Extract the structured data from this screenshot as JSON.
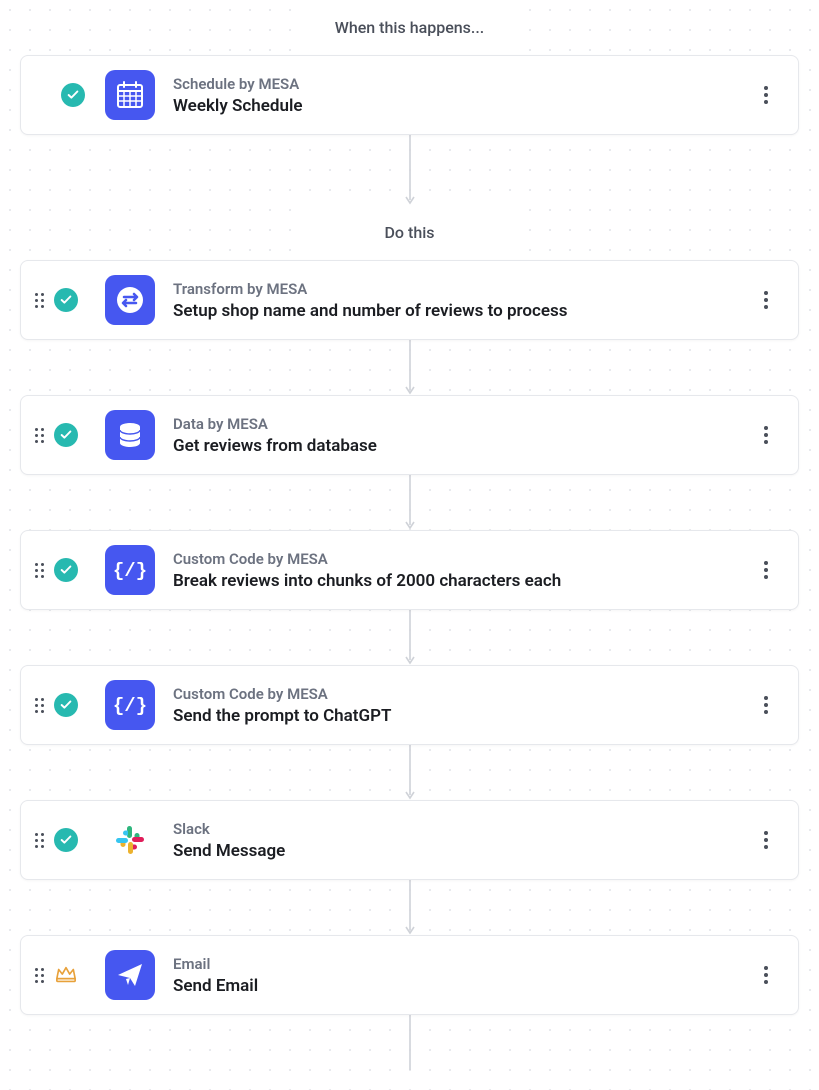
{
  "sections": {
    "trigger_header": "When this happens...",
    "actions_header": "Do this"
  },
  "trigger": {
    "app": "Schedule by MESA",
    "title": "Weekly Schedule",
    "status": "checked",
    "icon": "calendar"
  },
  "actions": [
    {
      "app": "Transform by MESA",
      "title": "Setup shop name and number of reviews to process",
      "status": "checked",
      "icon": "transform"
    },
    {
      "app": "Data by MESA",
      "title": "Get reviews from database",
      "status": "checked",
      "icon": "database"
    },
    {
      "app": "Custom Code by MESA",
      "title": "Break reviews into chunks of 2000 characters each",
      "status": "checked",
      "icon": "code"
    },
    {
      "app": "Custom Code by MESA",
      "title": "Send the prompt to ChatGPT",
      "status": "checked",
      "icon": "code"
    },
    {
      "app": "Slack",
      "title": "Send Message",
      "status": "checked",
      "icon": "slack"
    },
    {
      "app": "Email",
      "title": "Send Email",
      "status": "crown",
      "icon": "email"
    }
  ]
}
